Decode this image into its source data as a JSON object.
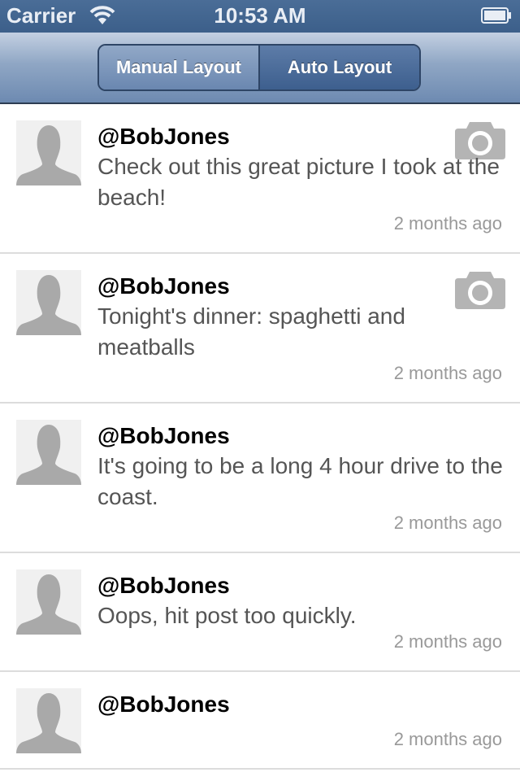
{
  "status_bar": {
    "carrier": "Carrier",
    "time": "10:53 AM",
    "wifi_icon": "wifi-icon",
    "battery_icon": "battery-icon"
  },
  "nav": {
    "segments": [
      "Manual Layout",
      "Auto Layout"
    ],
    "selected": "Auto Layout"
  },
  "colors": {
    "status_bar": "#3e628d",
    "selected_segment": "#3d5f8e",
    "timestamp": "#999999"
  },
  "feed": {
    "posts": [
      {
        "username": "@BobJones",
        "text": "Check out this great picture I took at the beach!",
        "time": "2 months ago",
        "icon": "camera-icon"
      },
      {
        "username": "@BobJones",
        "text": "Tonight's dinner: spaghetti and meatballs",
        "time": "2 months ago",
        "icon": "camera-icon"
      },
      {
        "username": "@BobJones",
        "text": "It's going to be a long 4 hour drive to the coast.",
        "time": "2 months ago"
      },
      {
        "username": "@BobJones",
        "text": "Oops, hit post too quickly.",
        "time": "2 months ago"
      },
      {
        "username": "@BobJones",
        "text": "",
        "time": "2 months ago"
      }
    ]
  }
}
